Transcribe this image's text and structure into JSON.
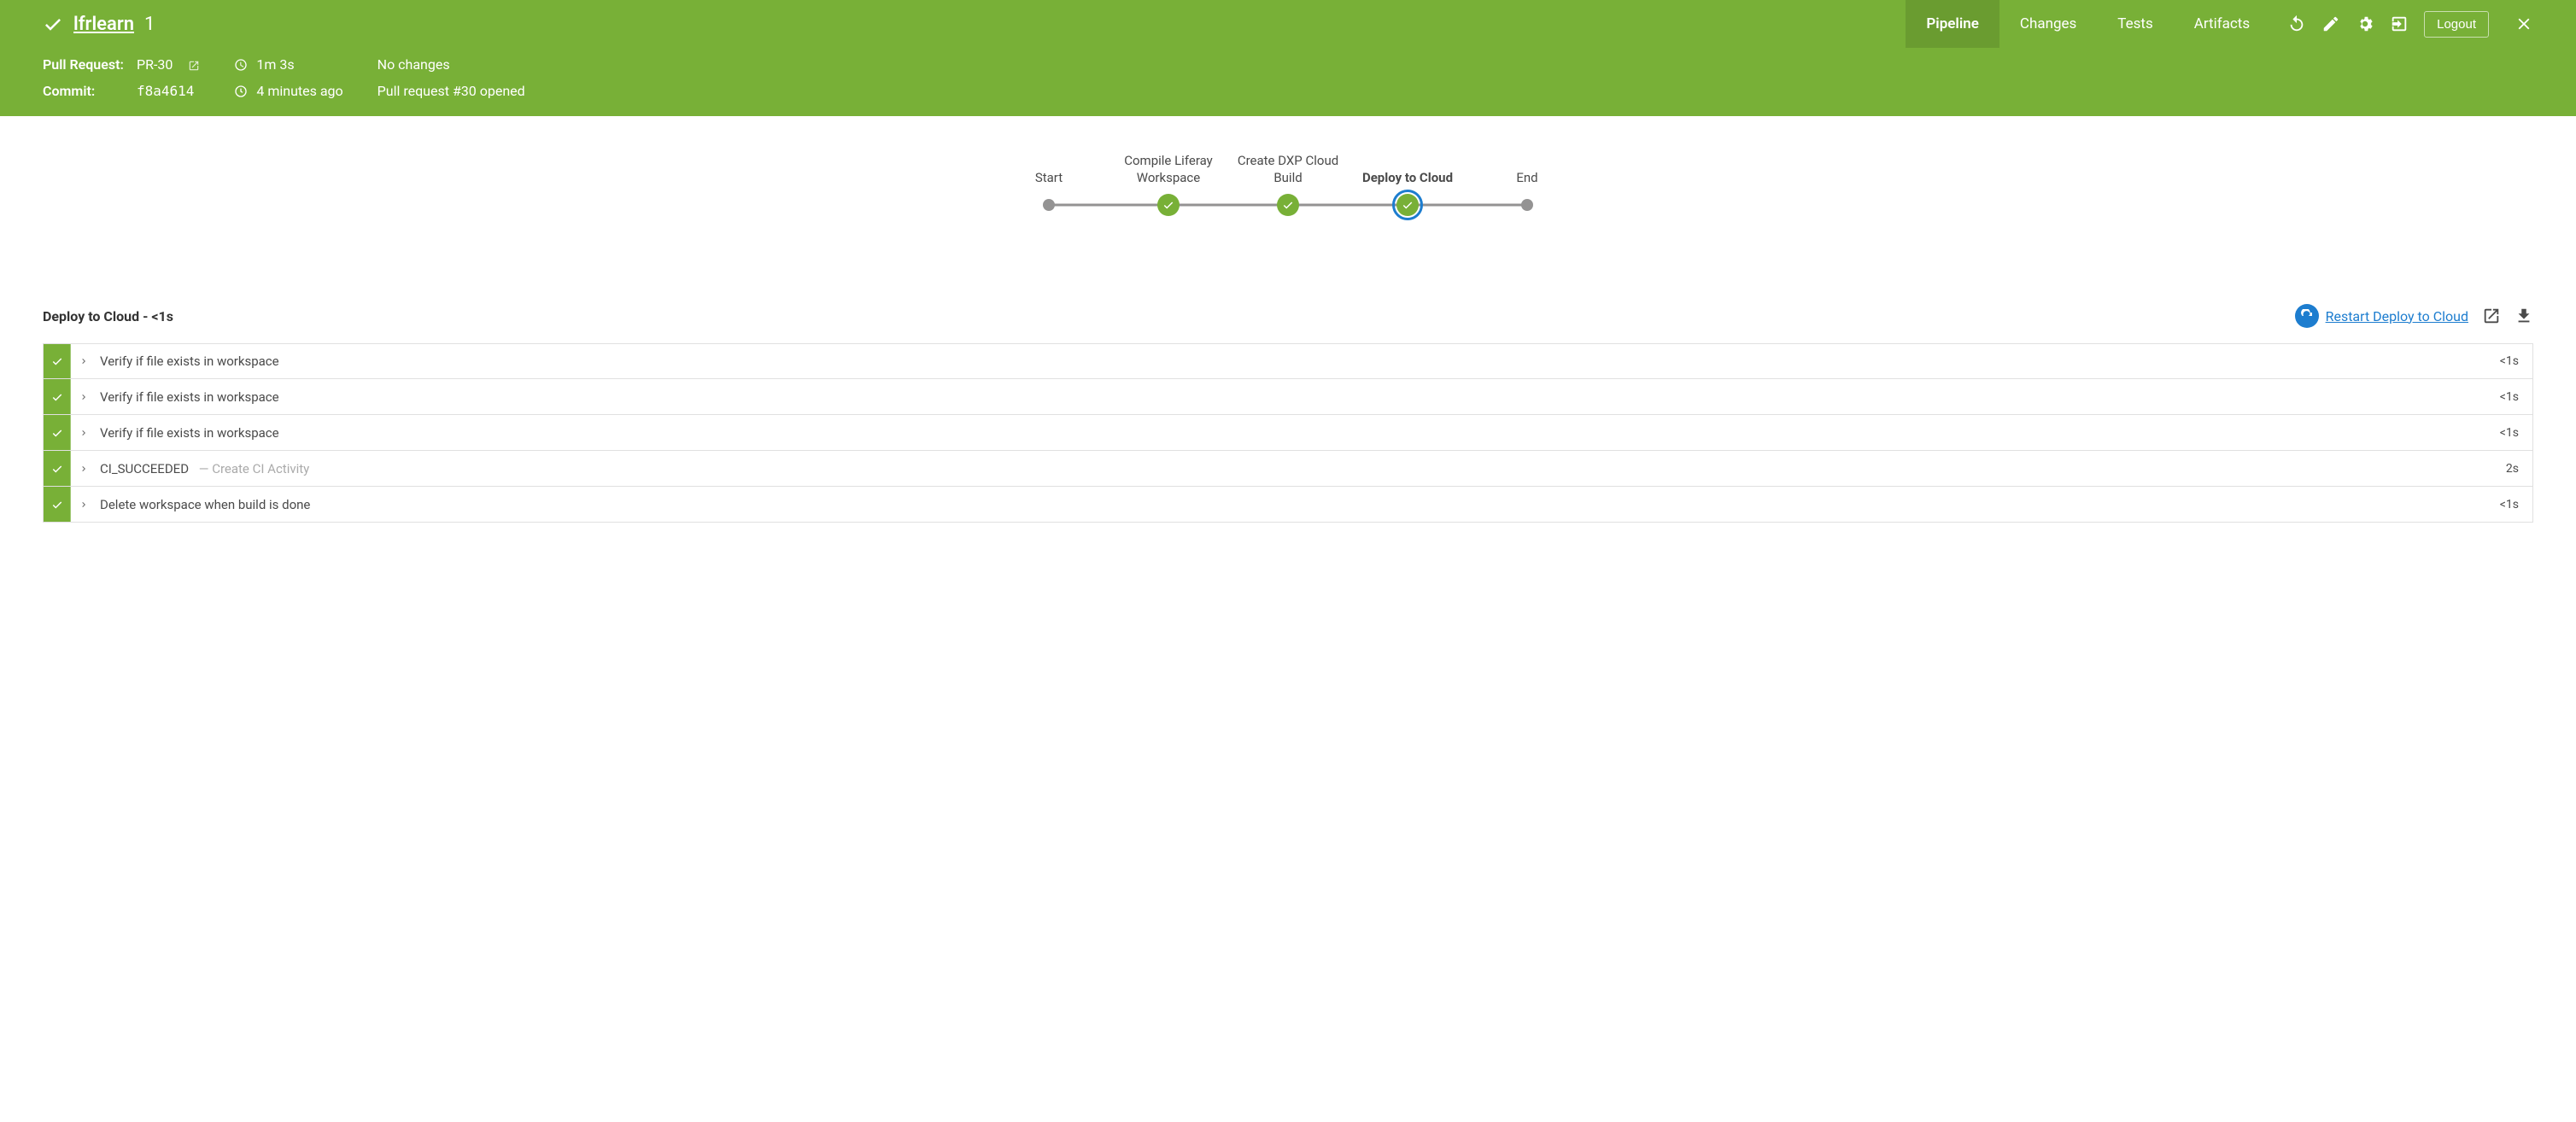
{
  "header": {
    "project_name": "lfrlearn",
    "run_number": "1",
    "tabs": {
      "pipeline": "Pipeline",
      "changes": "Changes",
      "tests": "Tests",
      "artifacts": "Artifacts"
    },
    "logout": "Logout"
  },
  "meta": {
    "pr_label": "Pull Request:",
    "pr_value": "PR-30",
    "commit_label": "Commit:",
    "commit_value": "f8a4614",
    "duration": "1m 3s",
    "time_ago": "4 minutes ago",
    "no_changes": "No changes",
    "pr_event": "Pull request #30 opened"
  },
  "stages": [
    {
      "label": "Start",
      "type": "dot"
    },
    {
      "label": "Compile Liferay Workspace",
      "type": "check"
    },
    {
      "label": "Create DXP Cloud Build",
      "type": "check"
    },
    {
      "label": "Deploy to Cloud",
      "type": "check",
      "selected": true,
      "bold": true
    },
    {
      "label": "End",
      "type": "dot"
    }
  ],
  "steps_section": {
    "title": "Deploy to Cloud - <1s",
    "restart": "Restart Deploy to Cloud"
  },
  "steps": [
    {
      "name": "Verify if file exists in workspace",
      "sub": "",
      "time": "<1s"
    },
    {
      "name": "Verify if file exists in workspace",
      "sub": "",
      "time": "<1s"
    },
    {
      "name": "Verify if file exists in workspace",
      "sub": "",
      "time": "<1s"
    },
    {
      "name": "CI_SUCCEEDED",
      "sub": "— Create CI Activity",
      "time": "2s"
    },
    {
      "name": "Delete workspace when build is done",
      "sub": "",
      "time": "<1s"
    }
  ]
}
